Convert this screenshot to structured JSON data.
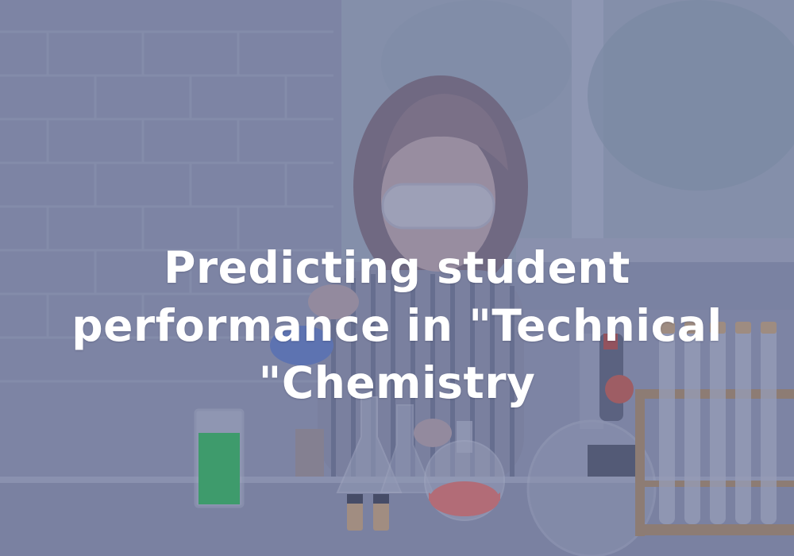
{
  "hero": {
    "title_lines": [
      "Predicting student",
      "performance in \"Technical",
      "\"Chemistry"
    ]
  },
  "colors": {
    "overlay": "#5b6590",
    "wall": "#8f96b0",
    "window": "#9aa7b8",
    "table": "#8a91ab",
    "green_liquid": "#2fb85a",
    "red_liquid": "#e0706a",
    "title_text": "#ffffff"
  },
  "scene_objects": [
    "brick-wall",
    "window",
    "girl-with-goggles",
    "lab-table",
    "beaker-green",
    "flask-red",
    "conical-flasks",
    "test-tube-rack",
    "microscope",
    "vials"
  ]
}
